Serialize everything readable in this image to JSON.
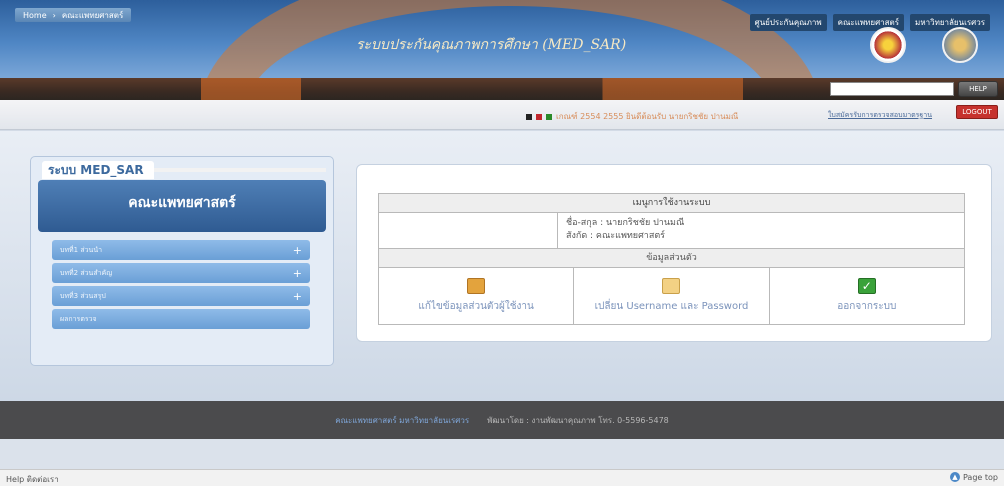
{
  "header": {
    "title": "ระบบประกันคุณภาพการศึกษา (MED_SAR)",
    "top_links": [
      "ศูนย์ประกันคุณภาพ",
      "คณะแพทยศาสตร์",
      "มหาวิทยาลัยนเรศวร"
    ]
  },
  "help": {
    "placeholder": "",
    "button": "HELP"
  },
  "breadcrumb": {
    "home": "Home",
    "current": "คณะแพทยศาสตร์"
  },
  "info_line": "เกณฑ์ 2554 2555 ยินดีต้อนรับ นายกริชชัย ปานมณี",
  "criteria_link": "ใบสมัครรับการตรวจสอบมาตรฐาน",
  "logout": "LOGOUT",
  "sidebar": {
    "system_tab": "ระบบ MED_SAR",
    "faculty": "คณะแพทยศาสตร์",
    "items": [
      {
        "label": "บทที่1 ส่วนนำ",
        "plus": "+"
      },
      {
        "label": "บทที่2 ส่วนสำคัญ",
        "plus": "+"
      },
      {
        "label": "บทที่3 ส่วนสรุป",
        "plus": "+"
      },
      {
        "label": "ผลการตรวจ",
        "plus": ""
      }
    ]
  },
  "panel": {
    "heading": "เมนูการใช้งานระบบ",
    "user_name_line": "ชื่อ-สกุล : นายกริชชัย ปานมณี",
    "user_org_line": "สังกัด : คณะแพทยศาสตร์",
    "subheading": "ข้อมูลส่วนตัว",
    "links": [
      {
        "label": "แก้ไขข้อมูลส่วนตัวผู้ใช้งาน",
        "icon": "user-edit-icon"
      },
      {
        "label": "เปลี่ยน Username และ Password",
        "icon": "mail-icon"
      },
      {
        "label": "ออกจากระบบ",
        "icon": "check-icon"
      }
    ]
  },
  "footer": {
    "left": "คณะแพทยศาสตร์ มหาวิทยาลัยนเรศวร",
    "right": "พัฒนาโดย : งานพัฒนาคุณภาพ โทร. 0-5596-5478"
  },
  "status": {
    "left": "Help  ติดต่อเรา",
    "right": "Page top"
  },
  "colors": {
    "accent": "#2f5b92",
    "logout": "#c6322e",
    "footer": "#4b4b4d"
  }
}
